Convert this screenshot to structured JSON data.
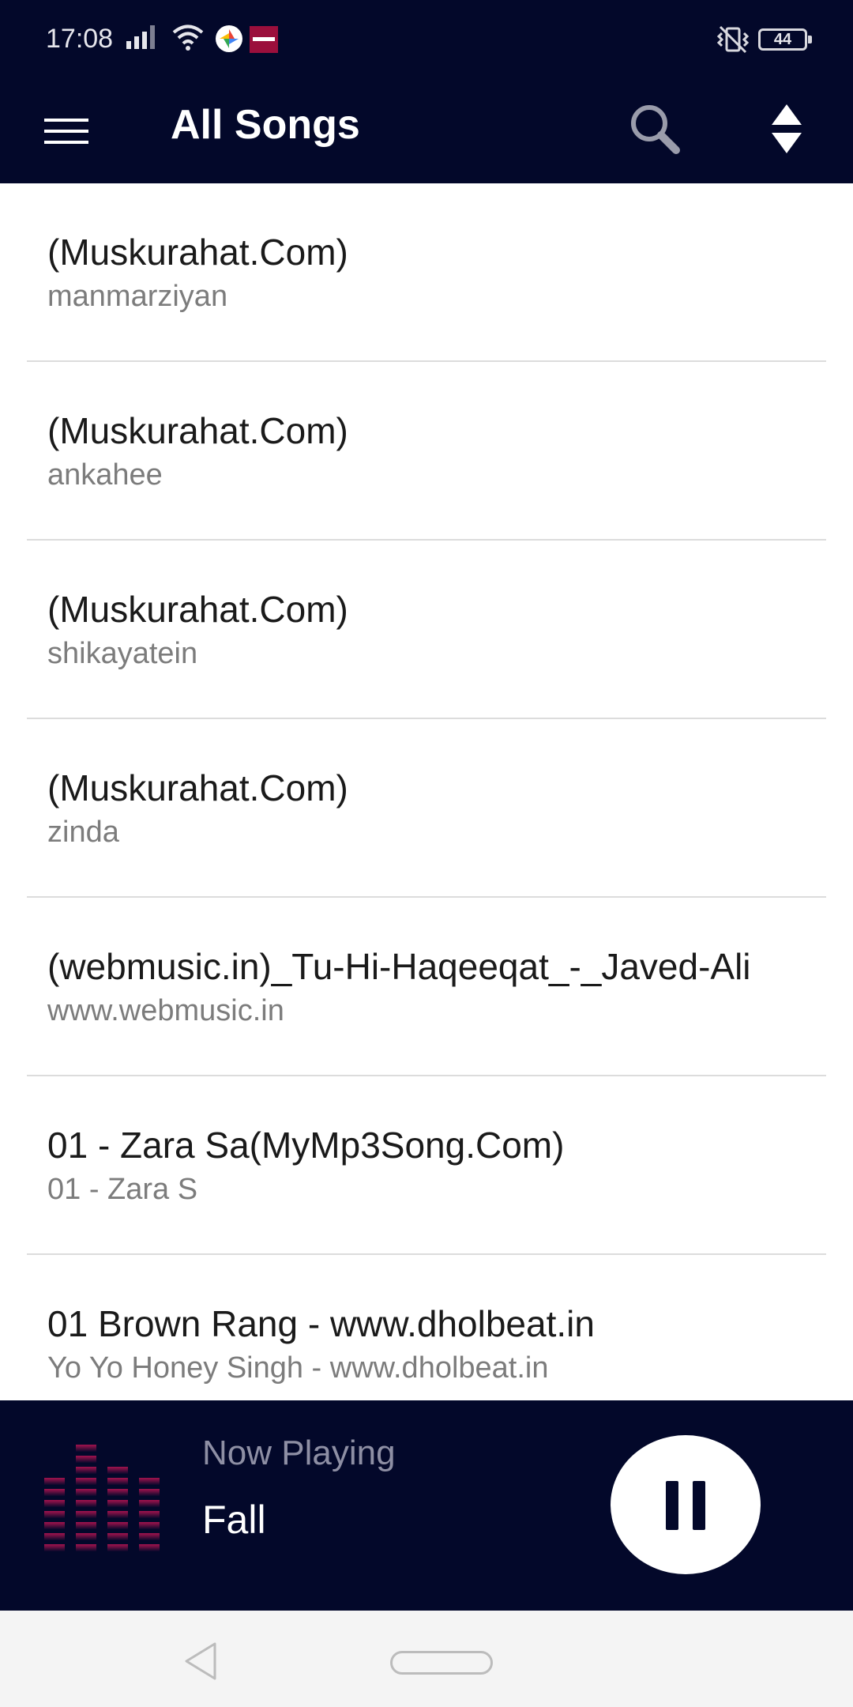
{
  "status_bar": {
    "time": "17:08",
    "battery": "44",
    "icons": [
      "signal-icon",
      "wifi-icon",
      "photos-app-icon",
      "echo-app-icon",
      "vibrate-off-icon",
      "battery-icon"
    ]
  },
  "toolbar": {
    "title": "All Songs",
    "icons": [
      "menu-icon",
      "search-icon",
      "sort-icon"
    ]
  },
  "songs": [
    {
      "title": "(Muskurahat.Com)",
      "artist": "manmarziyan"
    },
    {
      "title": "(Muskurahat.Com)",
      "artist": "ankahee"
    },
    {
      "title": "(Muskurahat.Com)",
      "artist": "shikayatein"
    },
    {
      "title": "(Muskurahat.Com)",
      "artist": "zinda"
    },
    {
      "title": "(webmusic.in)_Tu-Hi-Haqeeqat_-_Javed-Ali",
      "artist": "www.webmusic.in"
    },
    {
      "title": "01 - Zara Sa(MyMp3Song.Com)",
      "artist": "01 - Zara S"
    },
    {
      "title": "01 Brown Rang -  www.dholbeat.in",
      "artist": "Yo Yo Honey Singh - www.dholbeat.in"
    }
  ],
  "now_playing": {
    "label": "Now Playing",
    "title": "Fall",
    "icons": [
      "equalizer-icon",
      "pause-icon"
    ]
  },
  "colors": {
    "primary": "#03082a",
    "equalizer": "#a3134e",
    "divider": "#dcdcdc",
    "secondary_text": "#7c7c7c"
  }
}
